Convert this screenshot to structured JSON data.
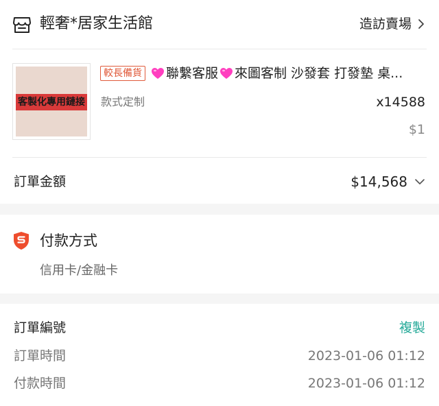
{
  "shop": {
    "name": "輕奢*居家生活館",
    "visit_label": "造訪賣場"
  },
  "product": {
    "tag": "較長備貨",
    "title": "聯繫客服",
    "title_rest": "來圖客制 沙發套 打發墊 桌...",
    "thumbnail_text": "客製化專用鏈接",
    "variation": "款式定制",
    "quantity": "x14588",
    "unit_price": "$1"
  },
  "order_total": {
    "label": "訂單金額",
    "value": "$14,568"
  },
  "payment": {
    "title": "付款方式",
    "method": "信用卡/金融卡"
  },
  "order_info": {
    "order_no_label": "訂單編號",
    "copy_label": "複製",
    "order_time_label": "訂單時間",
    "order_time": "2023-01-06 01:12",
    "pay_time_label": "付款時間",
    "pay_time": "2023-01-06 01:12"
  },
  "colors": {
    "accent_orange": "#ee4d2d",
    "copy_teal": "#26aa99",
    "tag_red": "#e05a3a",
    "heart_pink": "#ff3fbf"
  }
}
